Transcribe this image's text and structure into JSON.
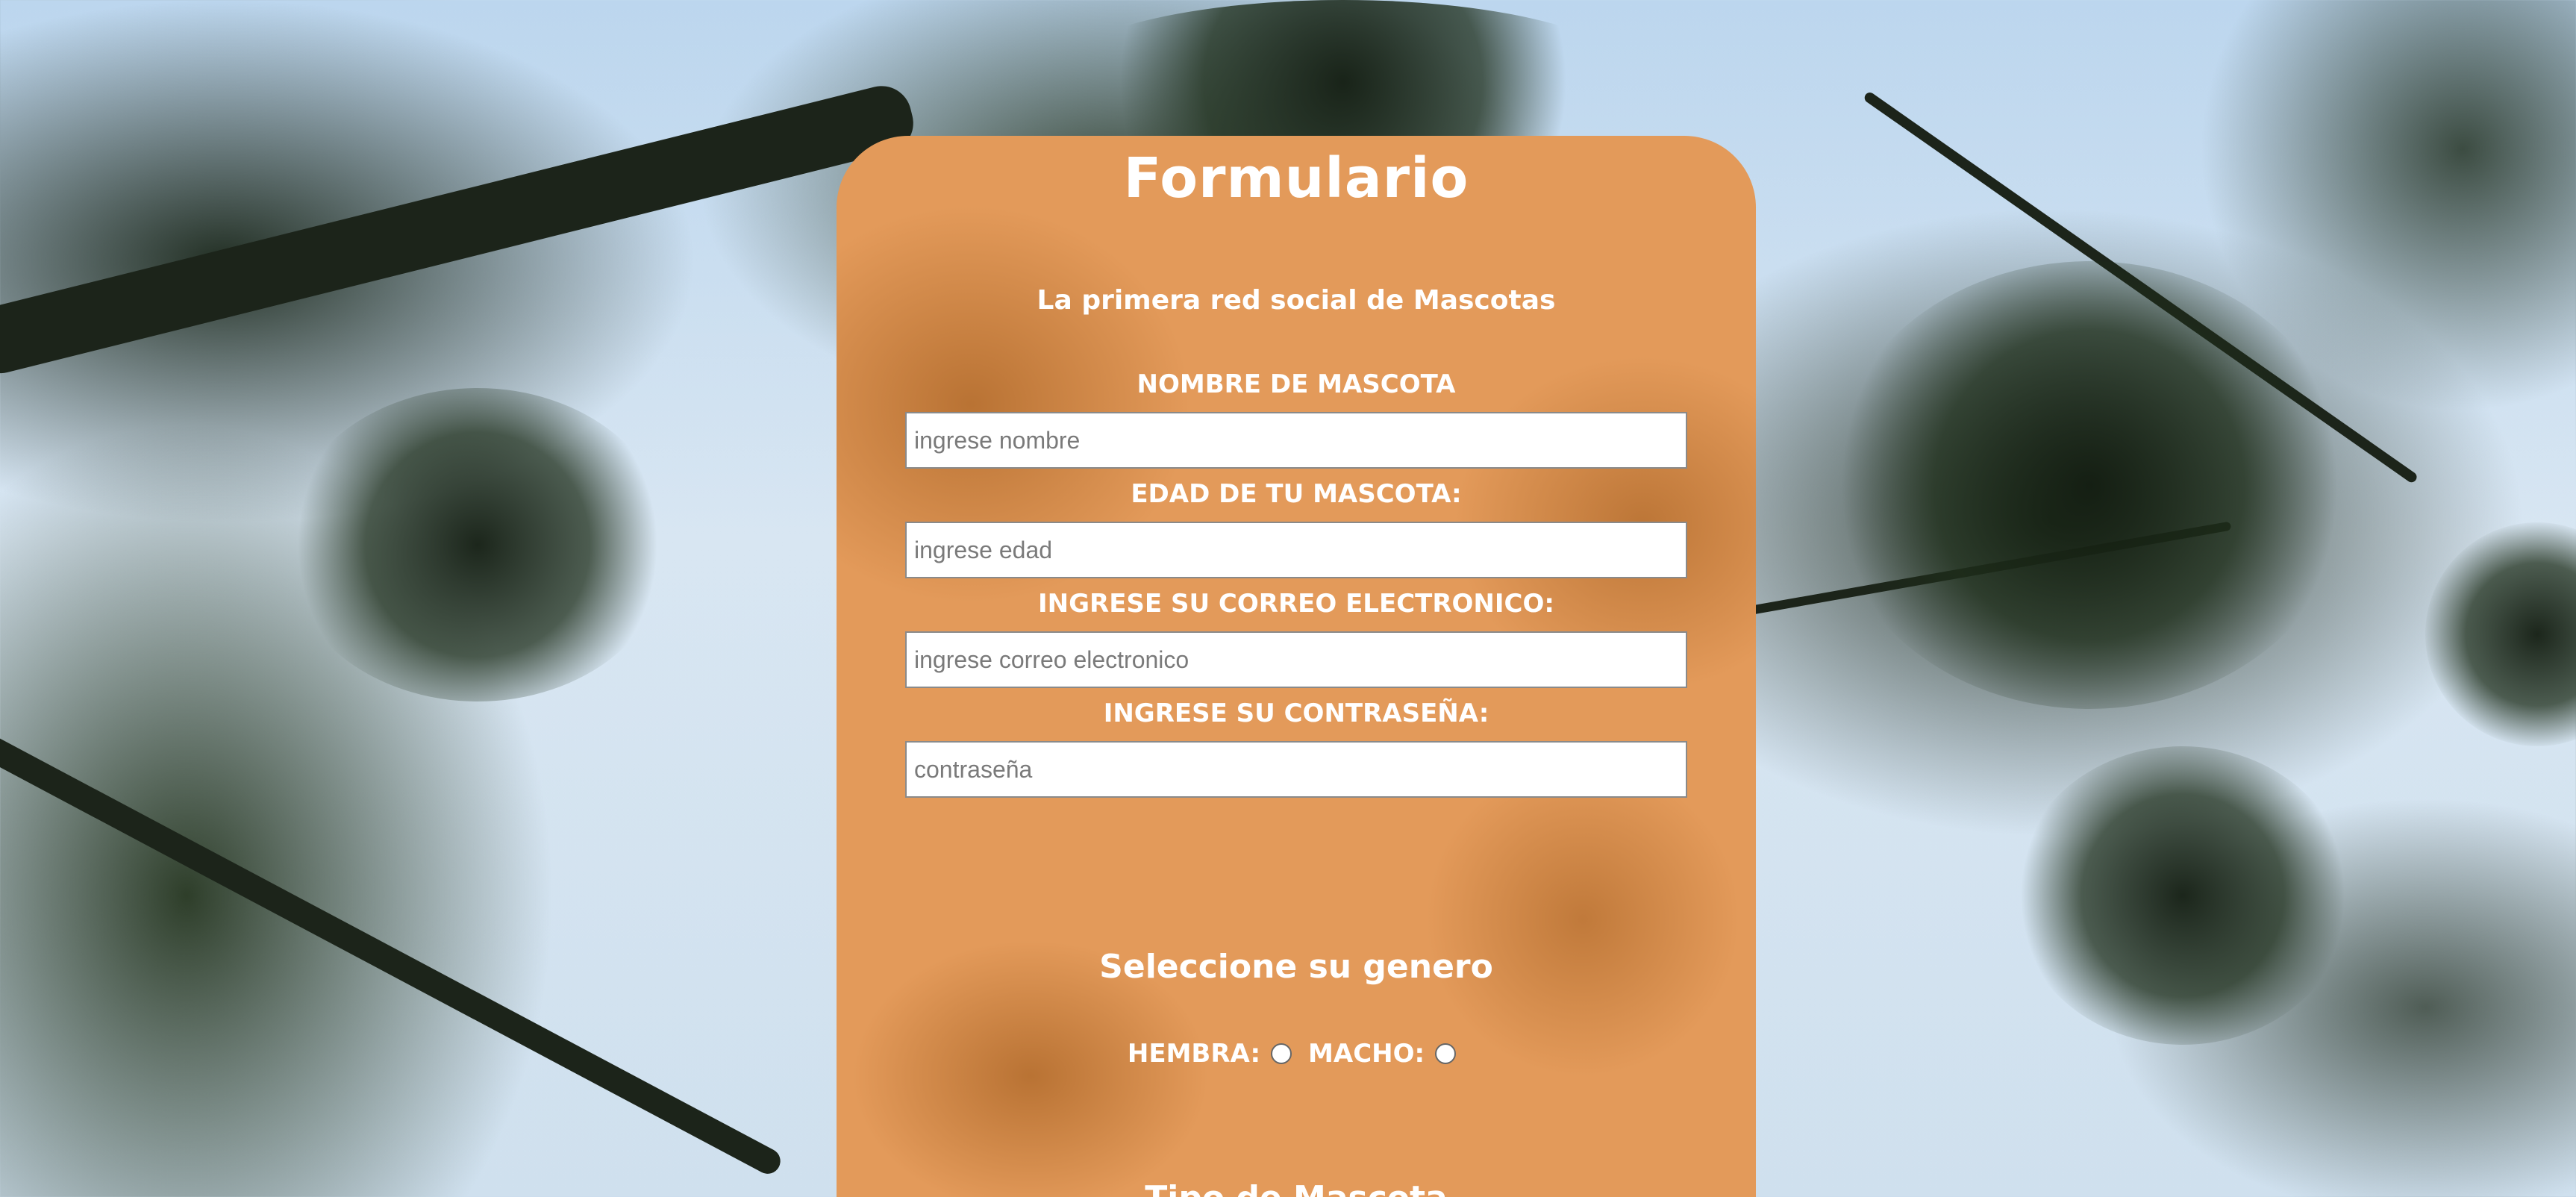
{
  "form": {
    "title": "Formulario",
    "subtitle": "La primera red social de Mascotas",
    "fields": [
      {
        "label": "NOMBRE DE MASCOTA",
        "placeholder": "ingrese nombre",
        "value": ""
      },
      {
        "label": "EDAD DE TU MASCOTA:",
        "placeholder": "ingrese edad",
        "value": ""
      },
      {
        "label": "INGRESE SU CORREO ELECTRONICO:",
        "placeholder": "ingrese correo electronico",
        "value": ""
      },
      {
        "label": "INGRESE SU CONTRASEÑA:",
        "placeholder": "contraseña",
        "value": ""
      }
    ],
    "gender": {
      "title": "Seleccione su genero",
      "options": [
        "HEMBRA:",
        "MACHO:"
      ]
    },
    "next_heading": "Tipo de Mascota"
  },
  "colors": {
    "card": "#e39a5a",
    "text": "#ffffff",
    "sky": "#d8e6f2",
    "foliage": "#1c241a"
  }
}
